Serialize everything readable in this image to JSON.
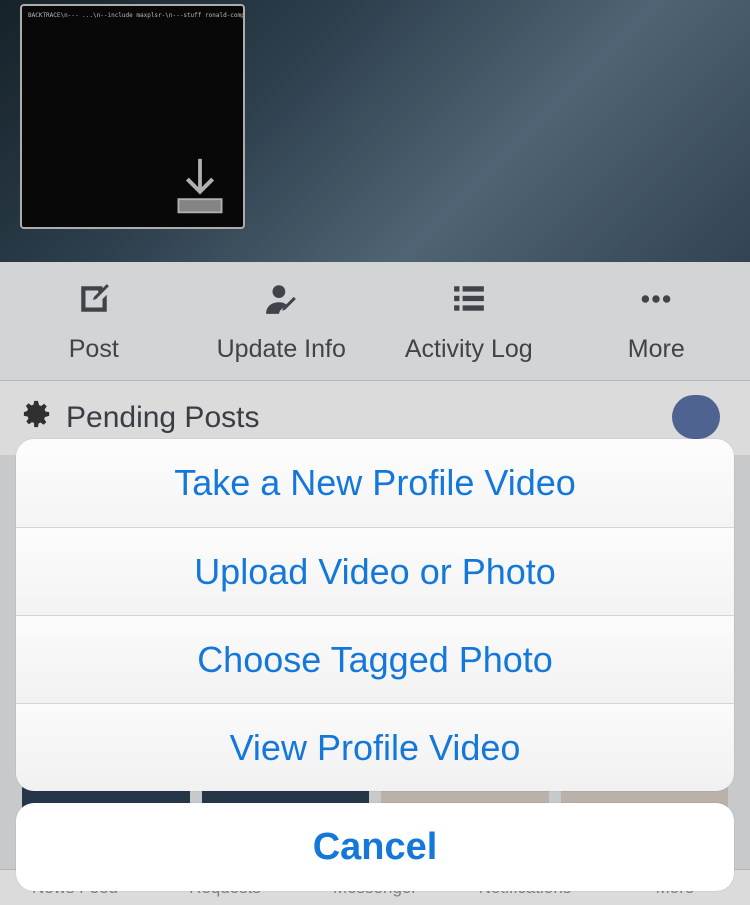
{
  "cover": {
    "terminal_snippet": "BACKTRACE\\n--- ...\\n--include maxplsr-\\n---stuff ronald-compile-\\n\\n\\n\\n-wetbeing.fkvp? ... /id.neverbeing.fkvp_14.2-\\nethatog.bp_14.0-8_ibphoote-arr.deb\\n  or and directories currently installed:\\n  /tmp_14.0-7 (using .../id.neverbeing.fkvp_14\\n  14.0-4\\n\\n!Bmpsshier root$ make package install:\\n /env/makefiles/targets/Darwin-arm/Iph-\\n /env/makefiles/targets/Darwin-arm/Iph-\\n\\n (internal-library-compile)"
  },
  "actions": {
    "post": {
      "label": "Post"
    },
    "update": {
      "label": "Update Info"
    },
    "activity": {
      "label": "Activity Log"
    },
    "more": {
      "label": "More"
    }
  },
  "pending": {
    "label": "Pending Posts"
  },
  "tabs": {
    "feed": "News Feed",
    "req": "Requests",
    "msg": "Messenger",
    "notif": "Notifications",
    "more": "More"
  },
  "sheet": {
    "options": [
      "Take a New Profile Video",
      "Upload Video or Photo",
      "Choose Tagged Photo",
      "View Profile Video"
    ],
    "cancel": "Cancel"
  }
}
